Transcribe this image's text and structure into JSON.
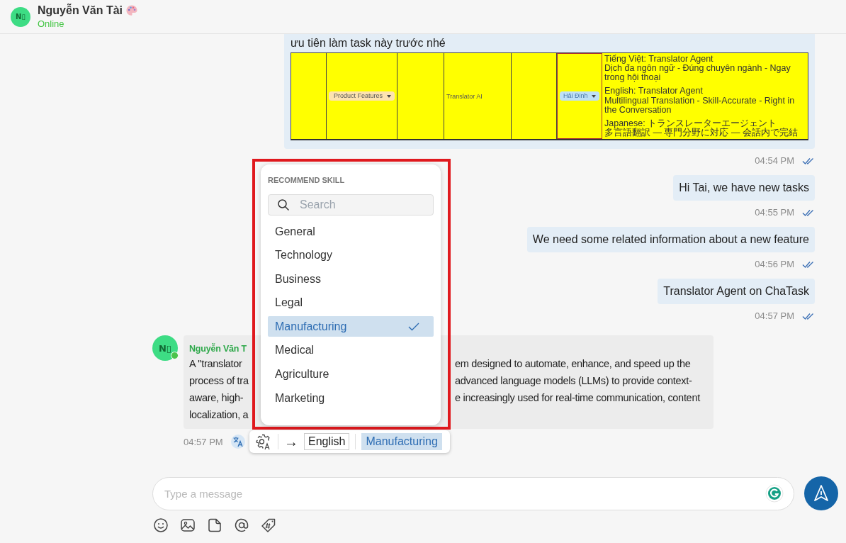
{
  "header": {
    "avatar_initials": "N▯",
    "name": "Nguyễn Văn Tài",
    "status": "Online"
  },
  "messages": [
    {
      "kind": "sheet",
      "caption": "ưu tiên làm task này trước nhé",
      "cells": [
        {
          "kind": "blank"
        },
        {
          "kind": "chip",
          "text": "Product Features",
          "color": "#fde3b0"
        },
        {
          "kind": "blank"
        },
        {
          "kind": "text",
          "text": "Translator AI"
        },
        {
          "kind": "blank"
        },
        {
          "kind": "chip",
          "text": "Hải Đinh",
          "color": "#bfe1f6"
        },
        {
          "kind": "notes",
          "paragraphs": [
            [
              "Tiếng Việt: Translator Agent",
              "Dịch đa ngôn ngữ - Đúng chuyên ngành - Ngay trong hội thoại"
            ],
            [
              "English: Translator Agent",
              "Multilingual Translation - Skill-Accurate - Right in the Conversation"
            ],
            [
              "Japanese: トランスレーターエージェント",
              "多言語翻訳 — 専門分野に対応 — 会話内で完結"
            ]
          ]
        }
      ],
      "time": "04:54 PM",
      "read": true
    },
    {
      "kind": "outgoing",
      "text": "Hi Tai, we have new tasks",
      "time": "04:55 PM",
      "read": true
    },
    {
      "kind": "outgoing",
      "text": "We need some related information about a new feature",
      "time": "04:56 PM",
      "read": true
    },
    {
      "kind": "outgoing",
      "text": "Translator Agent on ChaTask",
      "time": "04:57 PM",
      "read": true
    },
    {
      "kind": "incoming",
      "avatar_initials": "N▯",
      "online": true,
      "sender": "Nguyễn Văn T",
      "lines": [
        {
          "left": "A \"translator",
          "right": "em designed to automate, enhance, and speed up the"
        },
        {
          "left": "process of tra",
          "right": "advanced language models (LLMs) to provide context-"
        },
        {
          "left": "aware, high-",
          "right": "e increasingly used for real-time communication, content"
        },
        {
          "left": "localization, a"
        }
      ],
      "time": "04:57 PM",
      "translated": true
    }
  ],
  "skill_menu": {
    "title": "RECOMMEND SKILL",
    "search_placeholder": "Search",
    "items": [
      {
        "label": "General",
        "selected": false
      },
      {
        "label": "Technology",
        "selected": false
      },
      {
        "label": "Business",
        "selected": false
      },
      {
        "label": "Legal",
        "selected": false
      },
      {
        "label": "Manufacturing",
        "selected": true
      },
      {
        "label": "Medical",
        "selected": false
      },
      {
        "label": "Agriculture",
        "selected": false
      },
      {
        "label": "Marketing",
        "selected": false
      }
    ]
  },
  "translate_bar": {
    "arrow": "→",
    "target_language": "English",
    "skill": "Manufacturing"
  },
  "composer": {
    "placeholder": "Type a message"
  }
}
